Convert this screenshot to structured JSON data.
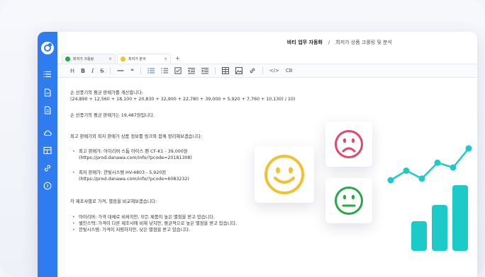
{
  "topbar": {
    "title": "바티 업무 자동화",
    "separator": "/",
    "subtitle": "최저가 상품 크롤링 및 분석"
  },
  "tabs": [
    {
      "label": "최저가 크롤링",
      "close": "×",
      "dot_color": "#27a84a"
    },
    {
      "label": "최저가 분석",
      "close": "×",
      "dot_color": "#f2c12e"
    }
  ],
  "tab_add": "+",
  "toolbar": {
    "heading": "H",
    "bold": "B",
    "italic": "I",
    "strike": "S",
    "quote": "❝",
    "code": "</>",
    "codeblock": "CB"
  },
  "sidebar_icons": [
    "list-icon",
    "file-icon",
    "document-icon",
    "cloud-icon",
    "table-icon",
    "link-icon",
    "help-icon"
  ],
  "document": {
    "line1": "손 선풍기의 평균 판매가를 계산합니다:",
    "line2": "(24,890 + 12,560 + 18,100 + 20,830 + 32,900 + 22,780 + 39,000 + 5,920 + 7,760 + 10,130) / 10)",
    "line3": "손 선풍기의 평균 판매가는 19,487원입니다.",
    "line4": "최고 판매가와 최저 판매가 상품 정보를 링크와 함께 정리해보겠습니다:",
    "max_item": "최고 판매가: 아이리버 스톰 아이스 팬 CF-K1 - 39,000원",
    "max_link": "(https://prod.danawa.com/info/?pcode=20181308)",
    "min_item": "최저 판매가: 한빛시스템 HV-4803 - 5,920원",
    "min_link": "(https://prod.danawa.com/info/?pcode=6083232)",
    "line5": "각 제조사별로 가격, 별점을 비교해보겠습니다:",
    "bullets": [
      "아이리버: 가격 대체로 비싸지만, 모든 제품이 높은 별점을 받고 있습니다.",
      "셀인스텍: 가격이 다른 제조사에 비해 낮지만, 평균적으로 높은 별점을 받고 있습니다.",
      "한빛시스템: 가격이 저렴하지만, 낮은 별점을 받고 있습니다."
    ]
  },
  "colors": {
    "sidebar": "#2f7cf0",
    "happy": "#f2c12e",
    "sad": "#e5476b",
    "neutral": "#27a84a",
    "chart": "#1ccbc8"
  },
  "chart_data": {
    "type": "line",
    "line": [
      0,
      0.3,
      0.05,
      0.55,
      0.4,
      1
    ],
    "bars": [
      0.45,
      0.7,
      1
    ]
  }
}
